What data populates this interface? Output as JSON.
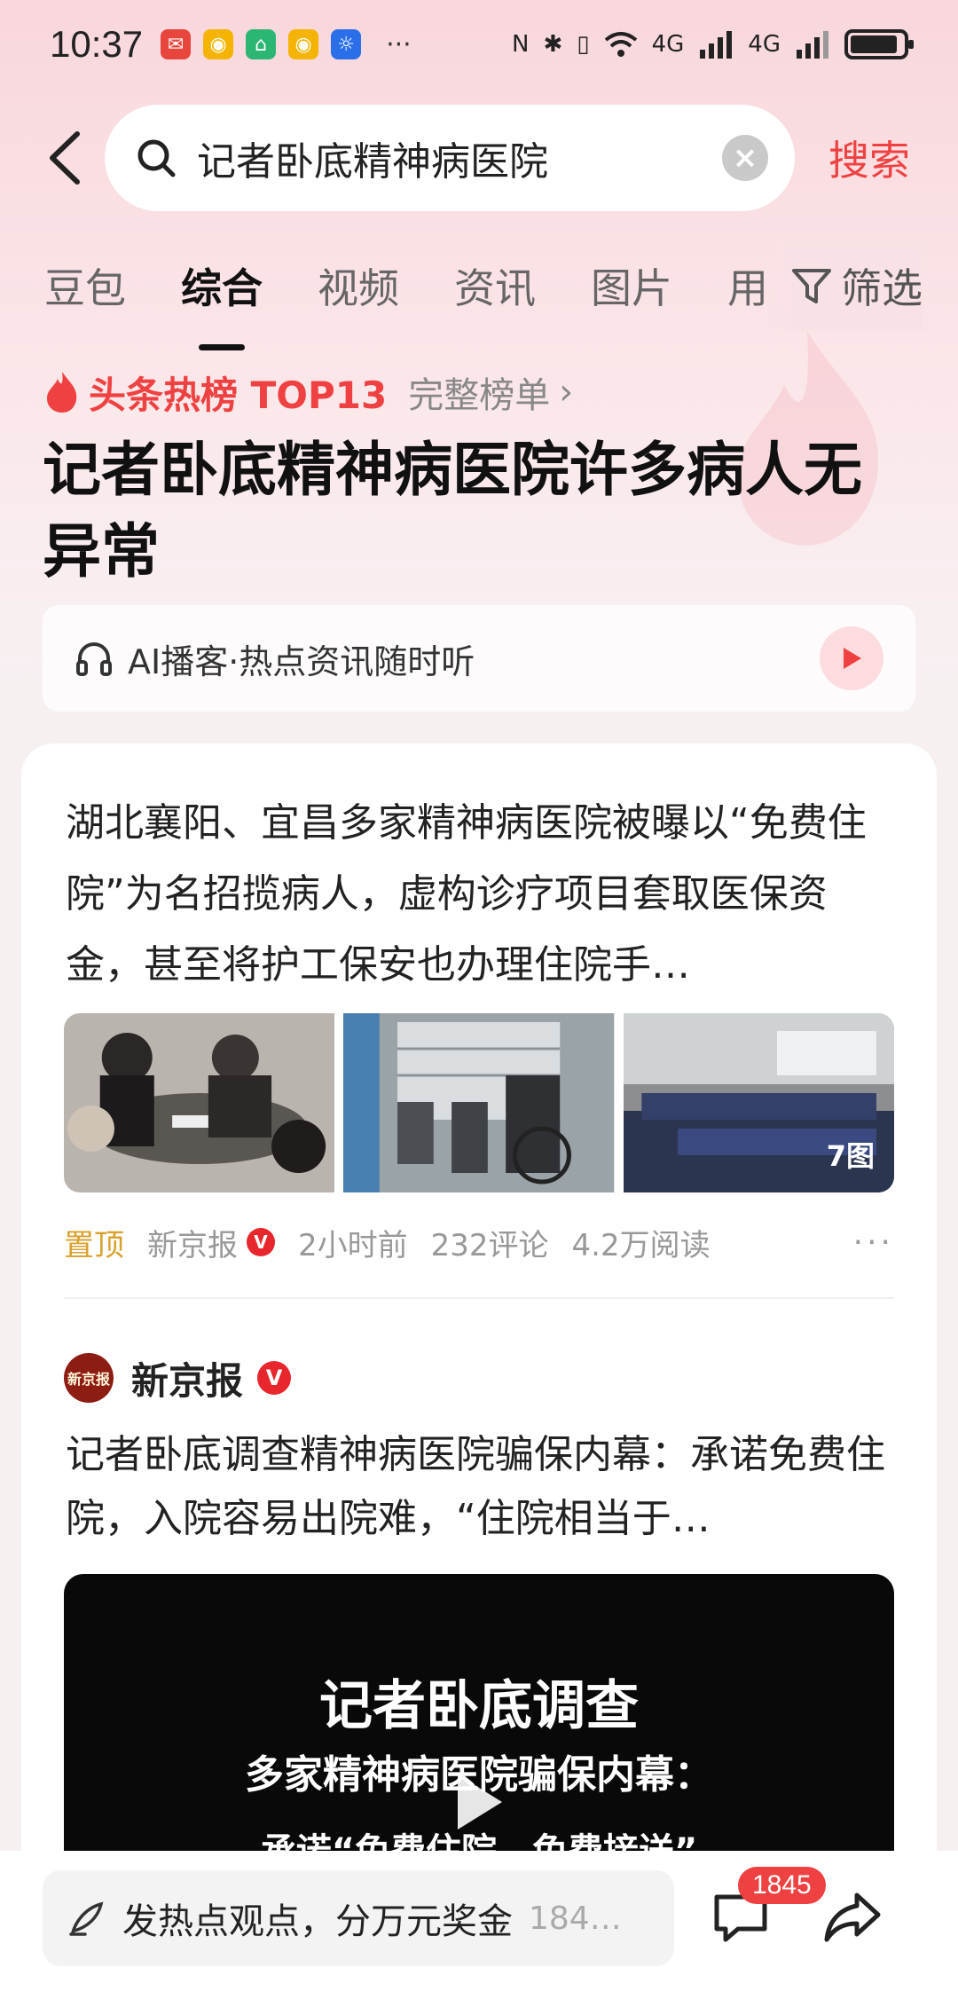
{
  "status_bar": {
    "time": "10:37",
    "more": "···",
    "network": "4G"
  },
  "search": {
    "query": "记者卧底精神病医院",
    "submit_label": "搜索"
  },
  "tabs": [
    {
      "label": "豆包"
    },
    {
      "label": "综合",
      "active": true
    },
    {
      "label": "视频"
    },
    {
      "label": "资讯"
    },
    {
      "label": "图片"
    },
    {
      "label": "用"
    }
  ],
  "filter_label": "筛选",
  "hot": {
    "label": "头条热榜 TOP13",
    "full_list": "完整榜单",
    "headline": "记者卧底精神病医院许多病人无异常"
  },
  "ai_podcast": {
    "text": "AI播客·热点资讯随时听"
  },
  "article1": {
    "text": "湖北襄阳、宜昌多家精神病医院被曝以“免费住院”为名招揽病人，虚构诊疗项目套取医保资金，甚至将护工保安也办理住院手…",
    "image_count": "7图",
    "pinned": "置顶",
    "source": "新京报",
    "verified": "V",
    "time": "2小时前",
    "comments": "232评论",
    "reads": "4.2万阅读",
    "more": "···"
  },
  "article2": {
    "author": "新京报",
    "avatar_text": "新京报",
    "verified": "V",
    "text": "记者卧底调查精神病医院骗保内幕：承诺免费住院，入院容易出院难，“住院相当于…",
    "video_title": "记者卧底调查",
    "video_subtitle": "多家精神病医院骗保内幕：",
    "video_subtitle2": "承诺“免费住院，免费接送”"
  },
  "bottom_bar": {
    "comment_placeholder": "发热点观点，分万元奖金",
    "comment_count_inline": "184…",
    "comment_badge": "1845"
  },
  "colors": {
    "accent": "#f04142",
    "pinned": "#d8a02c",
    "background_top": "#f8d7dc"
  }
}
